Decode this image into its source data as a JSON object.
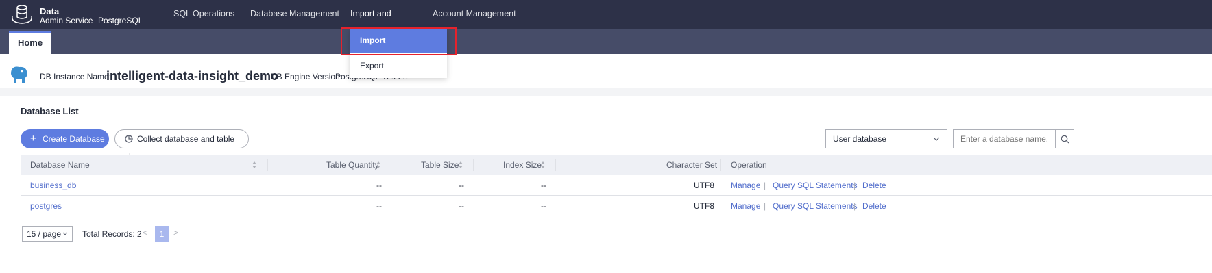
{
  "brand": {
    "line1": "Data",
    "line2": "Admin Service",
    "engine": "PostgreSQL"
  },
  "nav": {
    "items": [
      {
        "label": "SQL Operations"
      },
      {
        "label": "Database Management"
      },
      {
        "label": "Import and Export"
      },
      {
        "label": "Account Management"
      }
    ],
    "active": "Import and Export"
  },
  "tabs": {
    "home": "Home"
  },
  "dropdown": {
    "items": [
      {
        "label": "Import"
      },
      {
        "label": "Export"
      }
    ],
    "selected": "Import"
  },
  "instance": {
    "name_label": "DB Instance Name:",
    "name": "intelligent-data-insight_demo",
    "engine_label": "DB Engine Version:",
    "engine_value": "PostgreSQL 12.22.7"
  },
  "database_list": {
    "title": "Database List",
    "create_button": "Create Database",
    "collect_button": "Collect database and table size",
    "filter_select": "User database",
    "search_placeholder": "Enter a database name.",
    "columns": [
      "Database Name",
      "Table Quantity",
      "Table Size",
      "Index Size",
      "Character Set",
      "Operation"
    ],
    "rows": [
      {
        "name": "business_db",
        "table_quantity": "--",
        "table_size": "--",
        "index_size": "--",
        "charset": "UTF8"
      },
      {
        "name": "postgres",
        "table_quantity": "--",
        "table_size": "--",
        "index_size": "--",
        "charset": "UTF8"
      }
    ],
    "operations": {
      "manage": "Manage",
      "sep": "|",
      "query": "Query SQL Statements",
      "delete": "Delete"
    }
  },
  "pagination": {
    "page_size": "15 / page",
    "total": "Total Records: 2",
    "prev": "<",
    "current": "1",
    "next": ">"
  },
  "colors": {
    "topbar": "#2d3148",
    "tabbar": "#464c68",
    "accent": "#5e7ce0",
    "link": "#526ecc",
    "highlight": "#e6222c"
  }
}
